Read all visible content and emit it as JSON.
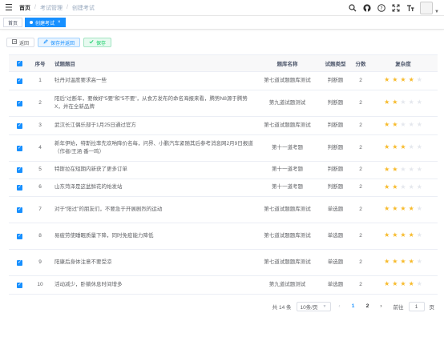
{
  "topbar": {
    "breadcrumbs": [
      "首页",
      "考试管理",
      "创建考试"
    ]
  },
  "tags": [
    {
      "label": "首页"
    },
    {
      "label": "创建考试"
    }
  ],
  "toolbar": {
    "back_label": "返回",
    "save_return_label": "保存并返回",
    "save_label": "保存"
  },
  "table": {
    "headers": {
      "no": "序号",
      "title": "试题题目",
      "bank": "题库名称",
      "type": "试题类型",
      "score": "分数",
      "difficulty": "复杂度"
    },
    "rows": [
      {
        "no": "1",
        "title": "牡丹对温度要求高一些",
        "bank": "第七道试题题库测试",
        "type": "判断题",
        "score": "2",
        "stars": 4
      },
      {
        "no": "2",
        "title": "阳后“过断年，要做好“5要”和“5不要”，从食方发布的命名海报来看，腾势N8源于腾势X，并在全新品牌",
        "bank": "第九道试题测试",
        "type": "判断题",
        "score": "2",
        "stars": 2
      },
      {
        "no": "3",
        "title": "武汉长江偶乐部于1月25日通过官方",
        "bank": "第七道试题题库测试",
        "type": "判断题",
        "score": "2",
        "stars": 2
      },
      {
        "no": "4",
        "title": "新年伊始，特斯拉率先欢呐降价名每，问界、小鹏汽车紧随其后参考消息网2月9日报道（作者/王涵 番一鸣）",
        "bank": "第十一道考题",
        "type": "判断题",
        "score": "2",
        "stars": 3
      },
      {
        "no": "5",
        "title": "特斯拉在短期内新获了更多订单",
        "bank": "第十一道考题",
        "type": "判断题",
        "score": "2",
        "stars": 2
      },
      {
        "no": "6",
        "title": "山东菏泽是这盆鲜花的始发站",
        "bank": "第十一道考题",
        "type": "判断题",
        "score": "2",
        "stars": 2
      },
      {
        "no": "7",
        "title": "对于“阳过”的朋友们，不要急于开展剧烈的运动",
        "bank": "第七道试题题库测试",
        "type": "单选题",
        "score": "2",
        "stars": 4
      },
      {
        "no": "8",
        "title": "易疲劳使睡眠质量下降，同时免疫能力降低",
        "bank": "第七道试题题库测试",
        "type": "单选题",
        "score": "2",
        "stars": 4
      },
      {
        "no": "9",
        "title": "阳康后身体注意不要受凉",
        "bank": "第七道试题题库测试",
        "type": "单选题",
        "score": "2",
        "stars": 4
      },
      {
        "no": "10",
        "title": "活动减少，卧躺休息时间增多",
        "bank": "第九道试题测试",
        "type": "单选题",
        "score": "2",
        "stars": 4
      }
    ]
  },
  "pagination": {
    "total_text": "共 14 条",
    "page_size_text": "10条/页",
    "pages": [
      "1",
      "2"
    ],
    "current_page": "1",
    "goto_label": "前往",
    "goto_value": "1",
    "page_unit": "页"
  },
  "colors": {
    "primary": "#1890ff",
    "success": "#13ce66",
    "star": "#f7ba2a"
  }
}
